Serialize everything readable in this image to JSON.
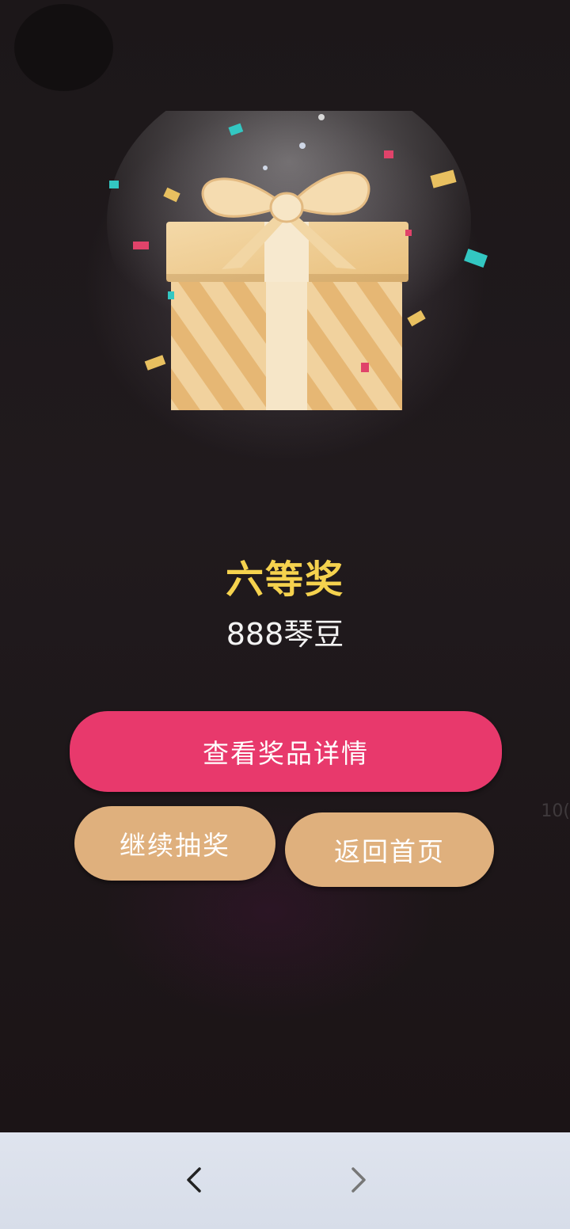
{
  "prize": {
    "title": "六等奖",
    "description": "888琴豆"
  },
  "buttons": {
    "view_details": "查看奖品详情",
    "continue_draw": "继续抽奖",
    "back_home": "返回首页"
  },
  "side_hint": "10(",
  "colors": {
    "primary": "#e8396c",
    "secondary": "#dfb07d",
    "prize_title": "#f5d24e",
    "background": "#1c1719"
  },
  "icons": {
    "gift": "gift-box-icon",
    "nav_back": "chevron-left-icon",
    "nav_forward": "chevron-right-icon"
  }
}
